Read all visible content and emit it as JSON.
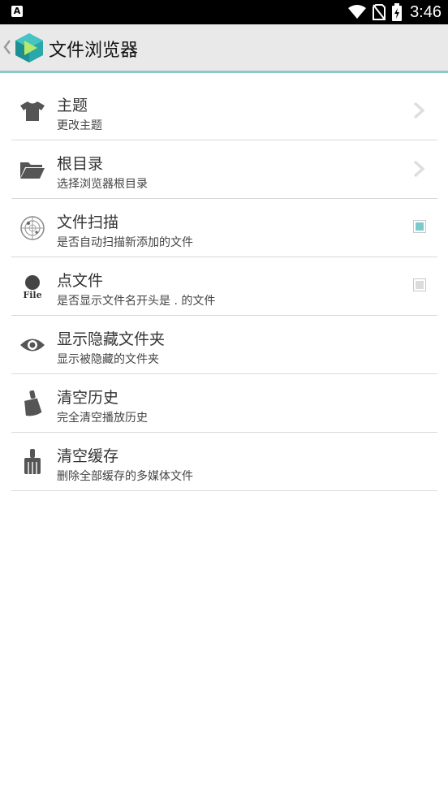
{
  "status_bar": {
    "time": "3:46",
    "notification_icon": "a-icon",
    "icons": [
      "wifi-icon",
      "no-sim-icon",
      "battery-charging-icon"
    ]
  },
  "toolbar": {
    "title": "文件浏览器",
    "back_icon": "chevron-left-icon",
    "logo": "app-logo"
  },
  "settings": [
    {
      "id": "theme",
      "title": "主题",
      "subtitle": "更改主题",
      "icon": "tshirt-icon",
      "control": "chevron"
    },
    {
      "id": "root",
      "title": "根目录",
      "subtitle": "选择浏览器根目录",
      "icon": "folder-icon",
      "control": "chevron"
    },
    {
      "id": "scan",
      "title": "文件扫描",
      "subtitle": "是否自动扫描新添加的文件",
      "icon": "radar-icon",
      "control": "checkbox",
      "checked": true
    },
    {
      "id": "dotfile",
      "title": "点文件",
      "subtitle": "是否显示文件名开头是 . 的文件",
      "icon": "dot-file-icon",
      "icon_text": "File",
      "control": "checkbox",
      "checked": false
    },
    {
      "id": "hidden",
      "title": "显示隐藏文件夹",
      "subtitle": "显示被隐藏的文件夹",
      "icon": "eye-icon",
      "control": "none"
    },
    {
      "id": "clear-history",
      "title": "清空历史",
      "subtitle": "完全清空播放历史",
      "icon": "brush-icon",
      "control": "none"
    },
    {
      "id": "clear-cache",
      "title": "清空缓存",
      "subtitle": "删除全部缓存的多媒体文件",
      "icon": "broom-icon",
      "control": "none"
    }
  ],
  "colors": {
    "accent": "#8fc7c9",
    "checkbox_checked": "#7ccacb",
    "checkbox_unchecked": "#dcdcdc",
    "toolbar_bg": "#e9e9e9",
    "icon": "#555555"
  }
}
